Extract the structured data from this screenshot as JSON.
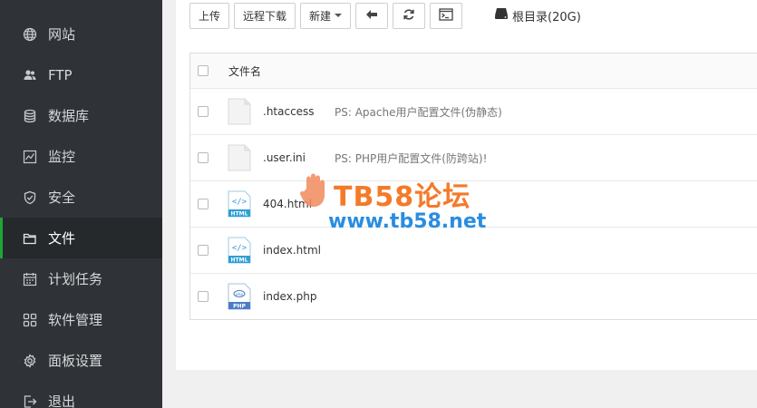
{
  "sidebar": {
    "items": [
      {
        "label": "网站",
        "icon": "globe-icon"
      },
      {
        "label": "FTP",
        "icon": "users-icon"
      },
      {
        "label": "数据库",
        "icon": "database-icon"
      },
      {
        "label": "监控",
        "icon": "monitor-chart-icon"
      },
      {
        "label": "安全",
        "icon": "shield-icon"
      },
      {
        "label": "文件",
        "icon": "folder-icon",
        "active": true
      },
      {
        "label": "计划任务",
        "icon": "calendar-icon"
      },
      {
        "label": "软件管理",
        "icon": "apps-grid-icon"
      },
      {
        "label": "面板设置",
        "icon": "gear-icon"
      },
      {
        "label": "退出",
        "icon": "logout-icon"
      }
    ]
  },
  "toolbar": {
    "upload_label": "上传",
    "remote_download_label": "远程下载",
    "new_label": "新建",
    "back_icon": "arrow-left-icon",
    "refresh_icon": "refresh-icon",
    "terminal_icon": "terminal-icon",
    "disk_label": "根目录(20G)"
  },
  "file_table": {
    "header": "文件名",
    "files": [
      {
        "name": ".htaccess",
        "ps": "PS: Apache用户配置文件(伪静态)",
        "type": "blank"
      },
      {
        "name": ".user.ini",
        "ps": "PS: PHP用户配置文件(防跨站)!",
        "type": "blank"
      },
      {
        "name": "404.html",
        "ps": "",
        "type": "html"
      },
      {
        "name": "index.html",
        "ps": "",
        "type": "html"
      },
      {
        "name": "index.php",
        "ps": "",
        "type": "php"
      }
    ]
  },
  "watermark": {
    "title": "TB58论坛",
    "url": "www.tb58.net"
  },
  "colors": {
    "sidebar_bg": "#2f3337",
    "active_accent": "#20a53a",
    "html_icon": "#2f9fd4",
    "php_icon": "#4b7cc4"
  }
}
